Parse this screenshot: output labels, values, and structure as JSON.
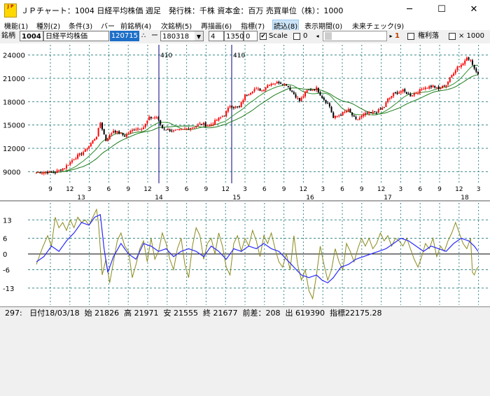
{
  "window": {
    "title": "ＪＰチャート：1004 日経平均株価 週足　発行株：千株 資本金：百万 売買単位（株）：1000",
    "icon_label": "J P",
    "minimize_icon": "minimize-icon",
    "maximize_icon": "maximize-icon",
    "close_icon": "close-icon"
  },
  "menu": [
    {
      "label": "機能(1)"
    },
    {
      "label": "種別(2)"
    },
    {
      "label": "条件(3)"
    },
    {
      "label": "バー"
    },
    {
      "label": "前銘柄(4)"
    },
    {
      "label": "次銘柄(5)"
    },
    {
      "label": "再描画(6)"
    },
    {
      "label": "指標(7)"
    },
    {
      "label": "読込(8)"
    },
    {
      "label": "表示期間(0)"
    },
    {
      "label": "未来チェック(9)"
    }
  ],
  "toolbar": {
    "brand_label": "銘柄",
    "code": "1004",
    "name": "日経平均株価",
    "number_badge": "120715",
    "dots": "∴",
    "dash": "ー",
    "date_value": "180318",
    "field_a": "4",
    "field_b": "1350",
    "field_c": "0",
    "scale_label": "Scale",
    "scale_checked": "✔",
    "zero_label": "0",
    "step_value": "1",
    "rights_label": "権利落",
    "multiplier_label": "× 1000"
  },
  "chart_data": [
    {
      "type": "candlestick",
      "title": "",
      "ylim": [
        7500,
        25500
      ],
      "yticks": [
        9000,
        12000,
        15000,
        18000,
        21000,
        24000
      ],
      "ytick_labels": [
        "9000",
        "12000",
        "15000",
        "18000",
        "21000",
        "24000"
      ],
      "month_ticks": [
        "9",
        "12",
        "3",
        "6",
        "9",
        "12",
        "3",
        "6",
        "9",
        "12",
        "3",
        "6",
        "9",
        "12",
        "3",
        "6",
        "9",
        "12",
        "3",
        "6",
        "9",
        "12",
        "3"
      ],
      "year_labels": [
        "13",
        "14",
        "15",
        "16",
        "17",
        "18"
      ],
      "annotations": [
        "410",
        "410"
      ],
      "close_anchors": [
        [
          0,
          8900
        ],
        [
          5,
          8950
        ],
        [
          10,
          8950
        ],
        [
          15,
          9500
        ],
        [
          20,
          10700
        ],
        [
          26,
          11700
        ],
        [
          32,
          13600
        ],
        [
          34,
          15300
        ],
        [
          37,
          13000
        ],
        [
          41,
          14300
        ],
        [
          47,
          13600
        ],
        [
          52,
          14500
        ],
        [
          57,
          14700
        ],
        [
          60,
          15900
        ],
        [
          64,
          16000
        ],
        [
          67,
          14600
        ],
        [
          73,
          14200
        ],
        [
          78,
          14400
        ],
        [
          84,
          14800
        ],
        [
          88,
          15200
        ],
        [
          92,
          14900
        ],
        [
          97,
          15800
        ],
        [
          100,
          16300
        ],
        [
          103,
          17500
        ],
        [
          105,
          17300
        ],
        [
          108,
          17300
        ],
        [
          111,
          18800
        ],
        [
          116,
          19600
        ],
        [
          120,
          19500
        ],
        [
          124,
          20300
        ],
        [
          129,
          20500
        ],
        [
          133,
          20200
        ],
        [
          137,
          19000
        ],
        [
          140,
          18100
        ],
        [
          144,
          19400
        ],
        [
          149,
          19700
        ],
        [
          152,
          18600
        ],
        [
          156,
          17400
        ],
        [
          158,
          15900
        ],
        [
          162,
          16400
        ],
        [
          166,
          16900
        ],
        [
          170,
          15600
        ],
        [
          175,
          16400
        ],
        [
          181,
          16700
        ],
        [
          185,
          17300
        ],
        [
          187,
          18300
        ],
        [
          190,
          19000
        ],
        [
          195,
          19400
        ],
        [
          199,
          18800
        ],
        [
          203,
          19300
        ],
        [
          206,
          19800
        ],
        [
          211,
          20000
        ],
        [
          214,
          19600
        ],
        [
          218,
          20200
        ],
        [
          221,
          21400
        ],
        [
          224,
          22500
        ],
        [
          227,
          22900
        ],
        [
          229,
          23800
        ],
        [
          231,
          23300
        ],
        [
          234,
          21700
        ]
      ]
    },
    {
      "type": "line",
      "title": "",
      "ylim": [
        -20,
        20
      ],
      "yticks": [
        -13,
        -6,
        0,
        6,
        13
      ],
      "ytick_labels": [
        "-13",
        "-6",
        "0",
        "6",
        "13"
      ],
      "series": [
        {
          "values_anchors": [
            [
              0,
              -3
            ],
            [
              4,
              -1
            ],
            [
              8,
              3
            ],
            [
              12,
              1
            ],
            [
              16,
              5
            ],
            [
              20,
              8
            ],
            [
              24,
              12
            ],
            [
              28,
              11
            ],
            [
              31,
              14
            ],
            [
              34,
              15
            ],
            [
              36,
              2
            ],
            [
              38,
              -7
            ],
            [
              41,
              -1
            ],
            [
              45,
              4
            ],
            [
              49,
              0
            ],
            [
              53,
              -2
            ],
            [
              57,
              4
            ],
            [
              61,
              3
            ],
            [
              65,
              1
            ],
            [
              69,
              2
            ],
            [
              73,
              -1
            ],
            [
              77,
              1
            ],
            [
              81,
              2
            ],
            [
              85,
              1
            ],
            [
              89,
              -1
            ],
            [
              93,
              3
            ],
            [
              97,
              1
            ],
            [
              101,
              -2
            ],
            [
              105,
              2
            ],
            [
              109,
              1
            ],
            [
              113,
              3
            ],
            [
              117,
              2
            ],
            [
              121,
              4
            ],
            [
              125,
              2
            ],
            [
              129,
              1
            ],
            [
              133,
              -2
            ],
            [
              137,
              -5
            ],
            [
              141,
              -8
            ],
            [
              145,
              -9
            ],
            [
              149,
              -8
            ],
            [
              152,
              -10
            ],
            [
              155,
              -11
            ],
            [
              158,
              -9
            ],
            [
              162,
              -5
            ],
            [
              166,
              -4
            ],
            [
              170,
              -2
            ],
            [
              174,
              -1
            ],
            [
              178,
              0
            ],
            [
              182,
              1
            ],
            [
              186,
              2
            ],
            [
              190,
              4
            ],
            [
              194,
              6
            ],
            [
              198,
              5
            ],
            [
              202,
              3
            ],
            [
              206,
              1
            ],
            [
              210,
              3
            ],
            [
              214,
              2
            ],
            [
              218,
              1
            ],
            [
              222,
              4
            ],
            [
              226,
              6
            ],
            [
              230,
              5
            ],
            [
              233,
              3
            ],
            [
              235,
              1
            ]
          ]
        },
        {
          "values_anchors": [
            [
              0,
              -4
            ],
            [
              3,
              2
            ],
            [
              6,
              7
            ],
            [
              8,
              3
            ],
            [
              10,
              14
            ],
            [
              12,
              10
            ],
            [
              14,
              12
            ],
            [
              16,
              9
            ],
            [
              18,
              13
            ],
            [
              20,
              10
            ],
            [
              22,
              14
            ],
            [
              24,
              12
            ],
            [
              26,
              13
            ],
            [
              28,
              11
            ],
            [
              30,
              14
            ],
            [
              32,
              17
            ],
            [
              33,
              12
            ],
            [
              35,
              -8
            ],
            [
              37,
              -2
            ],
            [
              39,
              -11
            ],
            [
              41,
              -3
            ],
            [
              43,
              5
            ],
            [
              45,
              8
            ],
            [
              47,
              3
            ],
            [
              49,
              1
            ],
            [
              51,
              -9
            ],
            [
              53,
              -4
            ],
            [
              55,
              2
            ],
            [
              57,
              5
            ],
            [
              59,
              -3
            ],
            [
              61,
              6
            ],
            [
              63,
              -2
            ],
            [
              65,
              1
            ],
            [
              67,
              8
            ],
            [
              69,
              4
            ],
            [
              71,
              -2
            ],
            [
              73,
              -6
            ],
            [
              75,
              2
            ],
            [
              77,
              6
            ],
            [
              79,
              -4
            ],
            [
              81,
              -9
            ],
            [
              83,
              3
            ],
            [
              85,
              10
            ],
            [
              87,
              7
            ],
            [
              89,
              -2
            ],
            [
              91,
              4
            ],
            [
              93,
              6
            ],
            [
              95,
              0
            ],
            [
              97,
              8
            ],
            [
              99,
              3
            ],
            [
              101,
              -5
            ],
            [
              103,
              -8
            ],
            [
              105,
              4
            ],
            [
              107,
              7
            ],
            [
              109,
              1
            ],
            [
              111,
              6
            ],
            [
              113,
              3
            ],
            [
              115,
              9
            ],
            [
              117,
              5
            ],
            [
              119,
              -1
            ],
            [
              121,
              7
            ],
            [
              123,
              4
            ],
            [
              125,
              8
            ],
            [
              127,
              2
            ],
            [
              129,
              -3
            ],
            [
              131,
              -5
            ],
            [
              133,
              0
            ],
            [
              135,
              -6
            ],
            [
              137,
              7
            ],
            [
              139,
              -4
            ],
            [
              141,
              -10
            ],
            [
              143,
              -6
            ],
            [
              145,
              -14
            ],
            [
              147,
              -17
            ],
            [
              149,
              -8
            ],
            [
              151,
              3
            ],
            [
              153,
              -4
            ],
            [
              155,
              -10
            ],
            [
              157,
              -6
            ],
            [
              159,
              2
            ],
            [
              161,
              -3
            ],
            [
              163,
              -6
            ],
            [
              165,
              4
            ],
            [
              167,
              1
            ],
            [
              169,
              -3
            ],
            [
              171,
              2
            ],
            [
              173,
              6
            ],
            [
              175,
              3
            ],
            [
              177,
              6
            ],
            [
              179,
              2
            ],
            [
              181,
              4
            ],
            [
              183,
              8
            ],
            [
              185,
              5
            ],
            [
              187,
              7
            ],
            [
              189,
              3
            ],
            [
              191,
              6
            ],
            [
              193,
              5
            ],
            [
              195,
              3
            ],
            [
              197,
              6
            ],
            [
              199,
              2
            ],
            [
              201,
              -2
            ],
            [
              203,
              -5
            ],
            [
              205,
              -1
            ],
            [
              207,
              4
            ],
            [
              209,
              2
            ],
            [
              211,
              6
            ],
            [
              213,
              -1
            ],
            [
              215,
              3
            ],
            [
              217,
              1
            ],
            [
              219,
              5
            ],
            [
              221,
              8
            ],
            [
              223,
              12
            ],
            [
              225,
              8
            ],
            [
              227,
              4
            ],
            [
              229,
              2
            ],
            [
              231,
              6
            ],
            [
              232,
              -7
            ],
            [
              233,
              -8
            ],
            [
              234,
              -6
            ],
            [
              235,
              -5
            ]
          ]
        }
      ]
    }
  ],
  "status": {
    "text": "297:   日付18/03/18  始 21826  高 21971  安 21555  終 21677  前差：208  出 619390  指標22175.28"
  },
  "colors": {
    "grid": "#3a8a8a",
    "up_candle": "#ff0000",
    "down_candle": "#000000",
    "ma_short": "#ff3b3b",
    "ma_mid": "#2f8f2f",
    "ma_long": "#1a7a1a",
    "marker_line": "#00007f",
    "osc_main": "#2a2aff",
    "osc_signal": "#8a8a1e",
    "badge_bg": "#1e6fc8"
  }
}
